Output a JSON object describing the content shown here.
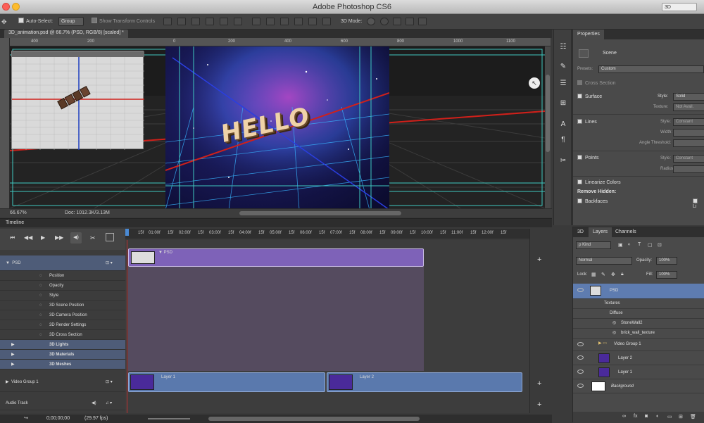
{
  "app": {
    "window_title": "Adobe Photoshop CS6",
    "workspace": "3D"
  },
  "options_bar": {
    "auto_select_label": "Auto-Select:",
    "auto_select_target": "Group",
    "show_transform_label": "Show Transform Controls",
    "mode_label": "3D Mode:"
  },
  "document": {
    "tab_label": "3D_animation.psd @ 66.7% (PSD, RGB/8) [scaled] *",
    "zoom": "66.67%",
    "doc_size": "Doc: 1012.3K/3.13M",
    "canvas_text": "HELLO",
    "ruler_ticks": [
      "400",
      "200",
      "0",
      "200",
      "400",
      "600",
      "800",
      "1000",
      "1100"
    ]
  },
  "properties": {
    "tabs": [
      "Properties"
    ],
    "panel_title": "Scene",
    "presets_label": "Presets:",
    "presets_value": "Custom",
    "cross_section": "Cross Section",
    "surface": "Surface",
    "style_label": "Style:",
    "style_value": "Solid",
    "texture_label": "Texture:",
    "texture_value": "Not Avail.",
    "lines": "Lines",
    "lines_style_value": "Constant",
    "width_label": "Width:",
    "angle_threshold_label": "Angle Threshold:",
    "points": "Points",
    "points_style_value": "Constant",
    "radius_label": "Radius:",
    "linearize_colors": "Linearize Colors",
    "remove_hidden": "Remove Hidden:",
    "backfaces": "Backfaces",
    "lines_right": "Li"
  },
  "timeline": {
    "title": "Timeline",
    "time_ticks": [
      "15f",
      "01:00f",
      "15f",
      "02:00f",
      "15f",
      "03:00f",
      "15f",
      "04:00f",
      "15f",
      "05:00f",
      "15f",
      "06:00f",
      "15f",
      "07:00f",
      "15f",
      "08:00f",
      "15f",
      "09:00f",
      "15f",
      "10:00f",
      "15f",
      "11:00f",
      "15f",
      "12:00f",
      "15f"
    ],
    "groups": [
      {
        "label": "PSD"
      },
      {
        "label": "Position"
      },
      {
        "label": "Opacity"
      },
      {
        "label": "Style"
      },
      {
        "label": "3D Scene Position"
      },
      {
        "label": "3D Camera Position"
      },
      {
        "label": "3D Render Settings"
      },
      {
        "label": "3D Cross Section"
      },
      {
        "label": "3D Lights"
      },
      {
        "label": "3D Materials"
      },
      {
        "label": "3D Meshes"
      }
    ],
    "video_group": "Video Group 1",
    "audio_track": "Audio Track",
    "psd_clip_label": "PSD",
    "clip_a_label": "Layer 1",
    "clip_b_label": "Layer 2",
    "current_time": "0;00;00;00",
    "fps": "(29.97 fps)"
  },
  "layers_panel": {
    "tabs": [
      "3D",
      "Layers",
      "Channels"
    ],
    "filter_label": "Kind",
    "blend_mode": "Normal",
    "opacity_label": "Opacity:",
    "opacity_value": "100%",
    "lock_label": "Lock:",
    "fill_label": "Fill:",
    "fill_value": "100%",
    "rows": [
      {
        "label": "PSD"
      },
      {
        "label": "Textures"
      },
      {
        "label": "Diffuse"
      },
      {
        "label": "StoneWall2"
      },
      {
        "label": "brick_wall_texture"
      },
      {
        "label": "Video Group 1"
      },
      {
        "label": "Layer 2"
      },
      {
        "label": "Layer 1"
      },
      {
        "label": "Background"
      }
    ]
  },
  "colors": {
    "accent": "#5e7cb0",
    "purple_track": "#7e62b8",
    "blue_track": "#5a79ad",
    "grid_red": "#d0201a",
    "guide_cyan": "#3fc9c0"
  }
}
